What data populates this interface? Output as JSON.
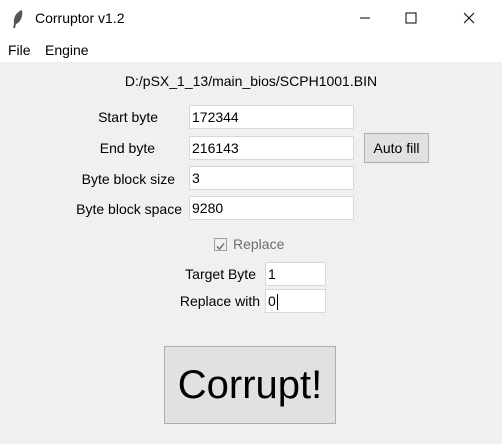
{
  "window": {
    "title": "Corruptor v1.2",
    "app_icon": "feather-icon",
    "controls": [
      "minimize-icon",
      "maximize-icon",
      "close-icon"
    ]
  },
  "menubar": {
    "items": [
      "File",
      "Engine"
    ]
  },
  "main": {
    "file_path": "D:/pSX_1_13/main_bios/SCPH1001.BIN",
    "start_byte": {
      "label": "Start byte",
      "value": "172344"
    },
    "end_byte": {
      "label": "End byte",
      "value": "216143"
    },
    "block_size": {
      "label": "Byte block size",
      "value": "3"
    },
    "block_space": {
      "label": "Byte block space",
      "value": "9280"
    },
    "auto_fill_label": "Auto fill",
    "replace": {
      "label": "Replace",
      "checked": true,
      "enabled": false
    },
    "target_byte": {
      "label": "Target Byte",
      "value": "1"
    },
    "replace_with": {
      "label": "Replace with",
      "value": "0"
    },
    "corrupt_label": "Corrupt!"
  }
}
